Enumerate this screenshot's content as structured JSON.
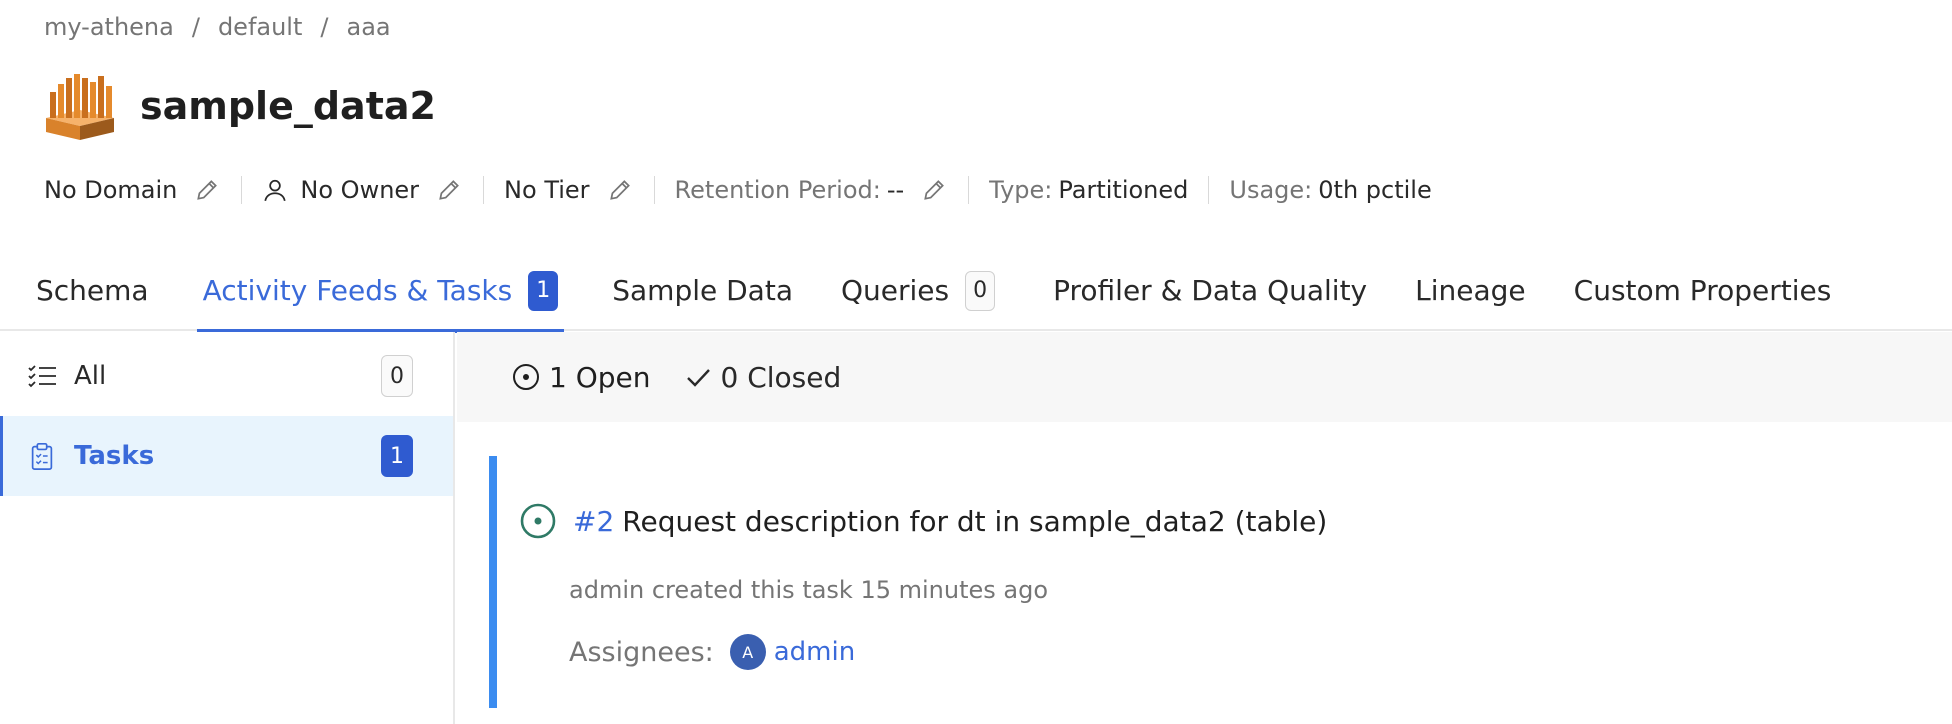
{
  "breadcrumb": [
    "my-athena",
    "default",
    "aaa"
  ],
  "entity": {
    "name": "sample_data2",
    "logo_icon": "athena-logo-icon"
  },
  "meta": {
    "domain": "No Domain",
    "owner": "No Owner",
    "tier": "No Tier",
    "retention_label": "Retention Period:",
    "retention_value": "--",
    "type_label": "Type:",
    "type_value": "Partitioned",
    "usage_label": "Usage:",
    "usage_value": "0th pctile"
  },
  "tabs": [
    {
      "label": "Schema",
      "count": null
    },
    {
      "label": "Activity Feeds & Tasks",
      "count": "1",
      "active": true
    },
    {
      "label": "Sample Data",
      "count": null
    },
    {
      "label": "Queries",
      "count": "0"
    },
    {
      "label": "Profiler & Data Quality",
      "count": null
    },
    {
      "label": "Lineage",
      "count": null
    },
    {
      "label": "Custom Properties",
      "count": null
    }
  ],
  "sidebar": {
    "items": [
      {
        "label": "All",
        "count": "0",
        "icon": "checklist-icon"
      },
      {
        "label": "Tasks",
        "count": "1",
        "icon": "clipboard-icon",
        "active": true
      }
    ]
  },
  "filters": {
    "open": "1 Open",
    "closed": "0 Closed"
  },
  "task": {
    "id": "#2",
    "title": "Request description for dt in sample_data2 (table)",
    "author": "admin",
    "created_text": "created this task 15 minutes ago",
    "assignees_label": "Assignees:",
    "assignee_initial": "A",
    "assignee_name": "admin"
  },
  "colors": {
    "accent": "#3a6ad9",
    "task_border": "#3b8cf0",
    "open_icon": "#2f7a66"
  }
}
